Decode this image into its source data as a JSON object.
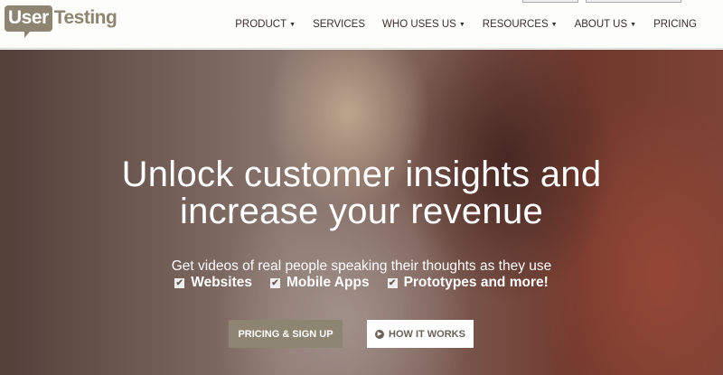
{
  "brand": {
    "logo_part1": "User",
    "logo_part2": "Testing"
  },
  "nav": [
    {
      "label": "PRODUCT",
      "dropdown": true
    },
    {
      "label": "SERVICES",
      "dropdown": false
    },
    {
      "label": "WHO USES US",
      "dropdown": true
    },
    {
      "label": "RESOURCES",
      "dropdown": true
    },
    {
      "label": "ABOUT US",
      "dropdown": true
    },
    {
      "label": "PRICING",
      "dropdown": false
    }
  ],
  "hero": {
    "headline_line1": "Unlock customer insights and",
    "headline_line2": "increase your revenue",
    "subtitle": "Get videos of real people speaking their thoughts as they use",
    "checks": [
      "Websites",
      "Mobile Apps",
      "Prototypes and more!"
    ],
    "primary_button": "PRICING & SIGN UP",
    "secondary_button": "HOW IT WORKS"
  },
  "colors": {
    "brand": "#8e8472",
    "nav_text": "#3a2e2a"
  }
}
